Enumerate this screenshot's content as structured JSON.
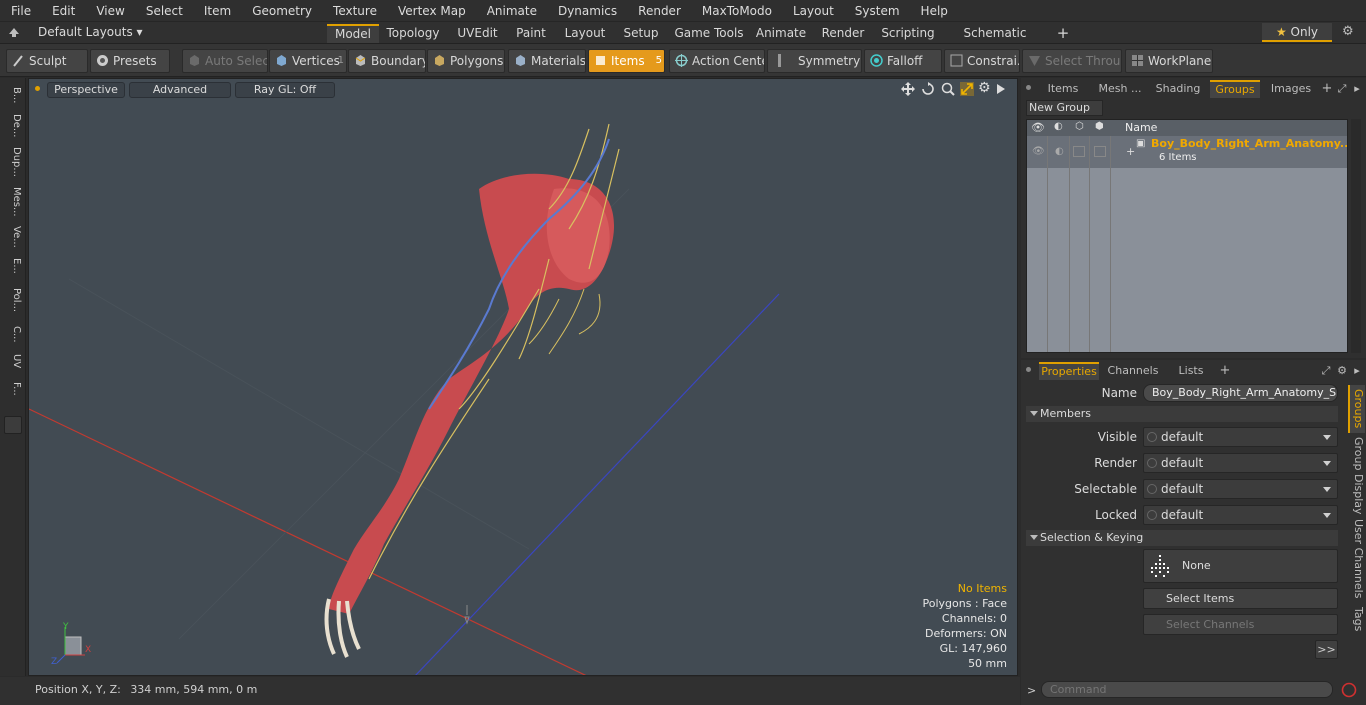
{
  "menu": [
    "File",
    "Edit",
    "View",
    "Select",
    "Item",
    "Geometry",
    "Texture",
    "Vertex Map",
    "Animate",
    "Dynamics",
    "Render",
    "MaxToModo",
    "Layout",
    "System",
    "Help"
  ],
  "layout": {
    "selector": "Default Layouts",
    "tabs": [
      "Model",
      "Topology",
      "UVEdit",
      "Paint",
      "Layout",
      "Setup",
      "Game Tools",
      "Animate",
      "Render",
      "Scripting",
      "Schematic Fusion"
    ],
    "active_tab": "Model",
    "only_label": "Only"
  },
  "toolbar": {
    "sculpt": "Sculpt",
    "presets": "Presets",
    "auto_select": "Auto Select",
    "vertices": "Vertices",
    "vertices_count": "1",
    "boundary": "Boundary",
    "polygons": "Polygons",
    "materials": "Materials",
    "items": "Items",
    "items_count": "5",
    "action_center": "Action Center",
    "symmetry": "Symmetry",
    "falloff": "Falloff",
    "constrain": "Constrai...",
    "select_through": "Select Through",
    "workplane": "WorkPlane"
  },
  "left_strip": [
    "B...",
    "De...",
    "Dup...",
    "Mes...",
    "Ve...",
    "E...",
    "Pol...",
    "C...",
    "UV",
    "F..."
  ],
  "viewport": {
    "view_mode": "Perspective",
    "shading": "Advanced",
    "raygl": "Ray GL: Off",
    "stats": {
      "selection": "No Items",
      "polygons": "Polygons : Face",
      "channels": "Channels: 0",
      "deformers": "Deformers: ON",
      "gl": "GL: 147,960",
      "scale": "50 mm"
    },
    "axis_x": "X",
    "axis_y": "Y",
    "axis_z": "Z"
  },
  "status": {
    "position_label": "Position X, Y, Z:",
    "position_value": "334 mm, 594 mm, 0 m"
  },
  "right_top": {
    "tabs": [
      "Items",
      "Mesh ...",
      "Shading",
      "Groups",
      "Images"
    ],
    "active_tab": "Groups",
    "new_group": "New Group",
    "column_name": "Name",
    "group": {
      "name": "Boy_Body_Right_Arm_Anatomy...",
      "count": "6 Items"
    }
  },
  "right_bottom": {
    "tabs": [
      "Properties",
      "Channels",
      "Lists"
    ],
    "active_tab": "Properties",
    "name_label": "Name",
    "name_value": "Boy_Body_Right_Arm_Anatomy_Skinle",
    "members_header": "Members",
    "fields": [
      {
        "label": "Visible",
        "value": "default"
      },
      {
        "label": "Render",
        "value": "default"
      },
      {
        "label": "Selectable",
        "value": "default"
      },
      {
        "label": "Locked",
        "value": "default"
      }
    ],
    "selection_header": "Selection & Keying",
    "keying_value": "None",
    "select_items": "Select Items",
    "select_channels": "Select Channels",
    "more": ">>",
    "side_tabs": [
      "Groups",
      "Group Display",
      "User Channels",
      "Tags"
    ]
  },
  "command": {
    "prompt": ">",
    "placeholder": "Command"
  },
  "colors": {
    "accent": "#e59a1c",
    "viewport_bg": "#424b53",
    "group_highlight": "#f0a800"
  }
}
